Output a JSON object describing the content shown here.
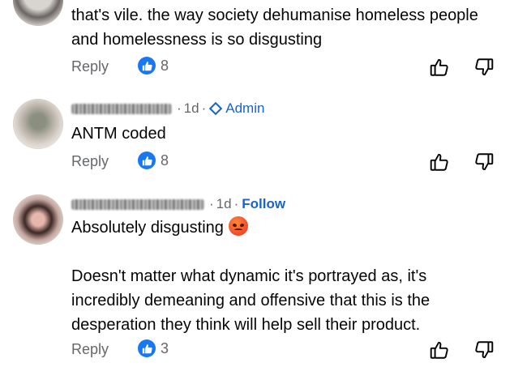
{
  "colors": {
    "link": "#1763cf",
    "like": "#1877f2",
    "meta": "#65676b"
  },
  "comments": [
    {
      "author_blurred": true,
      "meta": {
        "time": "",
        "role": "",
        "follow": ""
      },
      "paragraphs": [
        "that's vile. the way society dehumanise homeless people and homelessness is so disgusting"
      ],
      "reply_label": "Reply",
      "like_icon": "like-thumb-icon",
      "likes": "8"
    },
    {
      "author_blurred": true,
      "author_name": "Effie Kennedy",
      "meta": {
        "time": "1d",
        "role": "Admin"
      },
      "paragraphs": [
        "ANTM coded"
      ],
      "reply_label": "Reply",
      "likes": "8"
    },
    {
      "author_blurred": true,
      "author_name": "Simone Simi Nicol",
      "meta": {
        "time": "1d",
        "follow": "Follow"
      },
      "paragraphs": [
        "Absolutely disgusting",
        "Doesn't matter what dynamic it's portrayed as, it's incredibly demeaning and offensive that this is the desperation they think will help sell their product."
      ],
      "emoji": "angry-face-emoji",
      "reply_label": "Reply",
      "likes": "3"
    }
  ]
}
